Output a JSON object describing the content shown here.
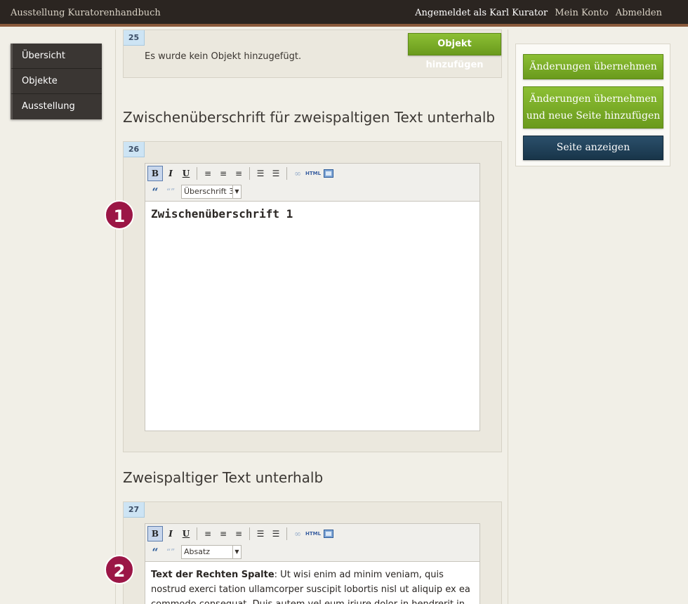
{
  "topbar": {
    "site_title": "Ausstellung Kuratorenhandbuch",
    "logged_in": "Angemeldet als Karl Kurator",
    "account": "Mein Konto",
    "logout": "Abmelden"
  },
  "nav": {
    "items": [
      {
        "label": "Übersicht"
      },
      {
        "label": "Objekte"
      },
      {
        "label": "Ausstellung"
      }
    ]
  },
  "blocks": {
    "b25": {
      "number": "25",
      "text": "Es wurde kein Objekt hinzugefügt.",
      "add_button": "Objekt hinzufügen"
    },
    "heading1": "Zwischenüberschrift für zweispaltigen Text unterhalb",
    "b26": {
      "number": "26",
      "format": "Überschrift 3",
      "content": "Zwischenüberschrift 1"
    },
    "heading2": "Zweispaltiger Text unterhalb",
    "b27": {
      "number": "27",
      "format": "Absatz",
      "content_bold": "Text der Rechten Spalte",
      "content_rest": ": Ut wisi enim ad minim veniam, quis nostrud exerci tation ullamcorper suscipit lobortis nisl ut aliquip ex ea commodo consequat. Duis autem vel eum iriure dolor in hendrerit in"
    }
  },
  "toolbar": {
    "bold": "B",
    "italic": "I",
    "underline": "U",
    "html": "HTML",
    "icons": [
      "bold-icon",
      "italic-icon",
      "underline-icon",
      "align-left-icon",
      "align-center-icon",
      "align-right-icon",
      "bullet-list-icon",
      "numbered-list-icon",
      "link-icon",
      "html-icon",
      "media-icon",
      "blockquote-icon",
      "unquote-icon"
    ]
  },
  "markers": {
    "m1": "1",
    "m2": "2"
  },
  "right_panel": {
    "save": "Änderungen übernehmen",
    "save_add_line1": "Änderungen übernehmen",
    "save_add_line2": "und neue Seite hinzufügen",
    "view": "Seite anzeigen"
  },
  "colors": {
    "topbar_bg": "#2b2521",
    "accent_green": "#7aab26",
    "accent_dark_blue": "#1f4058",
    "marker_red": "#9b1646",
    "block_number_bg": "#cde4f4"
  }
}
